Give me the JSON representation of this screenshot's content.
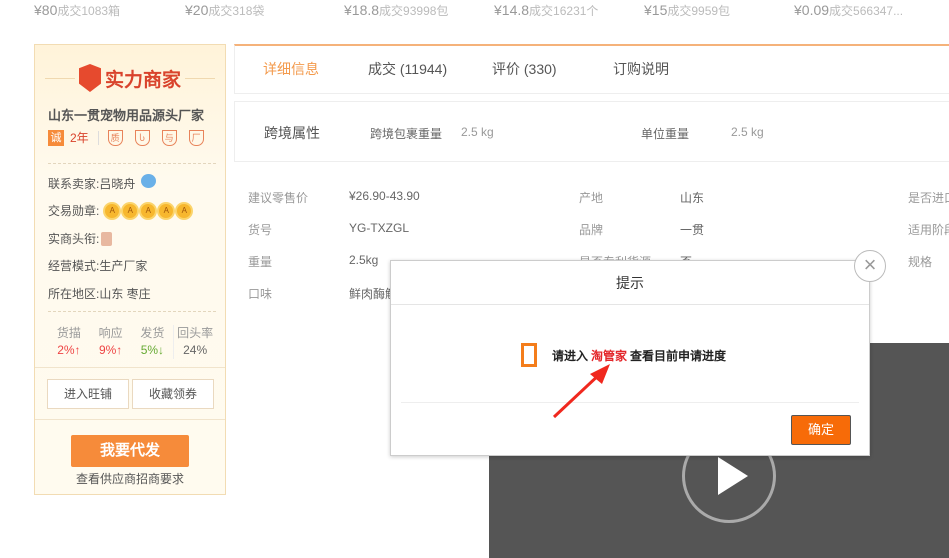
{
  "top_prices": [
    {
      "price": "¥80",
      "sold": "成交1083箱"
    },
    {
      "price": "¥20",
      "sold": "成交318袋"
    },
    {
      "price": "¥18.8",
      "sold": "成交93998包"
    },
    {
      "price": "¥14.8",
      "sold": "成交16231个"
    },
    {
      "price": "¥15",
      "sold": "成交9959包"
    },
    {
      "price": "¥0.09",
      "sold": "成交566347..."
    }
  ],
  "sidebar": {
    "logo_text": "实力商家",
    "shop_name": "山东一贯宠物用品源头厂家",
    "cert_badge": "诚",
    "years": "2年",
    "badges": [
      "质",
      "Ⴑ",
      "与",
      "厂"
    ],
    "contact_label": "联系卖家:",
    "contact_value": "吕晓舟",
    "medal_label": "交易勋章:",
    "medal_glyph": "A",
    "title_label": "实商头衔:",
    "mode_label": "经营模式:",
    "mode_value": "生产厂家",
    "region_label": "所在地区:",
    "region_value": "山东 枣庄",
    "stats": [
      {
        "label": "货描",
        "value": "2%↑",
        "trend": "up"
      },
      {
        "label": "响应",
        "value": "9%↑",
        "trend": "up"
      },
      {
        "label": "发货",
        "value": "5%↓",
        "trend": "down"
      },
      {
        "label": "回头率",
        "value": "24%"
      }
    ],
    "enter_shop": "进入旺铺",
    "favorite": "收藏领券",
    "dropship": "我要代发",
    "requirements": "查看供应商招商要求"
  },
  "tabs": [
    {
      "label": "详细信息",
      "active": true
    },
    {
      "label": "成交 (11944)"
    },
    {
      "label": "评价 (330)"
    },
    {
      "label": "订购说明"
    }
  ],
  "cross_border": {
    "title": "跨境属性",
    "pkg_label": "跨境包裹重量",
    "pkg_value": "2.5 kg",
    "unit_label": "单位重量",
    "unit_value": "2.5 kg"
  },
  "attrs": [
    {
      "l1": "建议零售价",
      "v1": "¥26.90-43.90",
      "l2": "产地",
      "v2": "山东",
      "l3": "是否进口"
    },
    {
      "l1": "货号",
      "v1": "YG-TXZGL",
      "l2": "品牌",
      "v2": "一贯",
      "l3": "适用阶段"
    },
    {
      "l1": "重量",
      "v1": "2.5kg",
      "l2": "是否专利货源",
      "v2": "否",
      "l3": "规格"
    },
    {
      "l1": "口味",
      "v1": "鲜肉酶解"
    }
  ],
  "dialog": {
    "title": "提示",
    "msg_pre": "请进入",
    "msg_link": "淘管家",
    "msg_post": "查看目前申请进度",
    "ok": "确定",
    "close": "×"
  },
  "colors": {
    "accent": "#f68b3a",
    "ok_button": "#f76b08",
    "link": "#e3262a"
  }
}
